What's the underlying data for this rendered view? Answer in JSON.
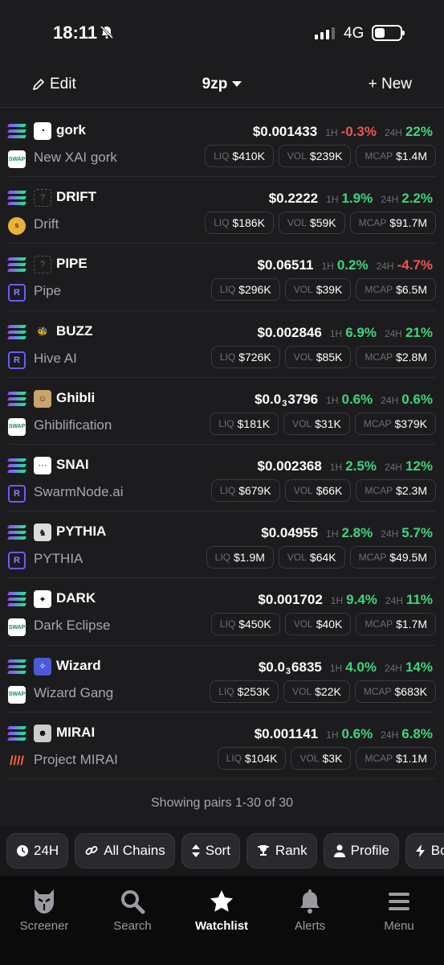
{
  "status_bar": {
    "time": "18:11",
    "network": "4G"
  },
  "nav": {
    "edit_label": "Edit",
    "title": "9zp",
    "new_label": "+ New"
  },
  "labels": {
    "h1": "1H",
    "h24": "24H",
    "liq": "LIQ",
    "vol": "VOL",
    "mcap": "MCAP"
  },
  "pairs": [
    {
      "symbol": "gork",
      "name": "New XAI gork",
      "dex": "swap",
      "price": "$0.001433",
      "price_zeros": "",
      "price_tail": "",
      "change_1h": "-0.3%",
      "change_24h": "22%",
      "liq": "$410K",
      "vol": "$239K",
      "mcap": "$1.4M"
    },
    {
      "symbol": "DRIFT",
      "name": "Drift",
      "dex": "drift",
      "price": "$0.2222",
      "price_zeros": "",
      "price_tail": "",
      "change_1h": "1.9%",
      "change_24h": "2.2%",
      "liq": "$186K",
      "vol": "$59K",
      "mcap": "$91.7M"
    },
    {
      "symbol": "PIPE",
      "name": "Pipe",
      "dex": "raydium",
      "price": "$0.06511",
      "price_zeros": "",
      "price_tail": "",
      "change_1h": "0.2%",
      "change_24h": "-4.7%",
      "liq": "$296K",
      "vol": "$39K",
      "mcap": "$6.5M"
    },
    {
      "symbol": "BUZZ",
      "name": "Hive AI",
      "dex": "raydium",
      "price": "$0.002846",
      "price_zeros": "",
      "price_tail": "",
      "change_1h": "6.9%",
      "change_24h": "21%",
      "liq": "$726K",
      "vol": "$85K",
      "mcap": "$2.8M"
    },
    {
      "symbol": "Ghibli",
      "name": "Ghiblification",
      "dex": "swap",
      "price": "$0.0",
      "price_zeros": "3",
      "price_tail": "3796",
      "change_1h": "0.6%",
      "change_24h": "0.6%",
      "liq": "$181K",
      "vol": "$31K",
      "mcap": "$379K"
    },
    {
      "symbol": "SNAI",
      "name": "SwarmNode.ai",
      "dex": "raydium",
      "price": "$0.002368",
      "price_zeros": "",
      "price_tail": "",
      "change_1h": "2.5%",
      "change_24h": "12%",
      "liq": "$679K",
      "vol": "$66K",
      "mcap": "$2.3M"
    },
    {
      "symbol": "PYTHIA",
      "name": "PYTHIA",
      "dex": "raydium",
      "price": "$0.04955",
      "price_zeros": "",
      "price_tail": "",
      "change_1h": "2.8%",
      "change_24h": "5.7%",
      "liq": "$1.9M",
      "vol": "$64K",
      "mcap": "$49.5M"
    },
    {
      "symbol": "DARK",
      "name": "Dark Eclipse",
      "dex": "swap",
      "price": "$0.001702",
      "price_zeros": "",
      "price_tail": "",
      "change_1h": "9.4%",
      "change_24h": "11%",
      "liq": "$450K",
      "vol": "$40K",
      "mcap": "$1.7M"
    },
    {
      "symbol": "Wizard",
      "name": "Wizard Gang",
      "dex": "swap",
      "price": "$0.0",
      "price_zeros": "3",
      "price_tail": "6835",
      "change_1h": "4.0%",
      "change_24h": "14%",
      "liq": "$253K",
      "vol": "$22K",
      "mcap": "$683K"
    },
    {
      "symbol": "MIRAI",
      "name": "Project MIRAI",
      "dex": "mirai",
      "price": "$0.001141",
      "price_zeros": "",
      "price_tail": "",
      "change_1h": "0.6%",
      "change_24h": "6.8%",
      "liq": "$104K",
      "vol": "$3K",
      "mcap": "$1.1M"
    }
  ],
  "showing_text": "Showing pairs 1-30 of 30",
  "filters": [
    {
      "label": "24H",
      "icon": "clock-icon"
    },
    {
      "label": "All Chains",
      "icon": "link-icon"
    },
    {
      "label": "Sort",
      "icon": "sort-icon"
    },
    {
      "label": "Rank",
      "icon": "trophy-icon"
    },
    {
      "label": "Profile",
      "icon": "profile-icon"
    },
    {
      "label": "Boos",
      "icon": "bolt-icon"
    }
  ],
  "tabs": [
    {
      "label": "Screener",
      "icon": "owl-icon",
      "active": false
    },
    {
      "label": "Search",
      "icon": "search-icon",
      "active": false
    },
    {
      "label": "Watchlist",
      "icon": "star-icon",
      "active": true
    },
    {
      "label": "Alerts",
      "icon": "bell-icon",
      "active": false
    },
    {
      "label": "Menu",
      "icon": "menu-icon",
      "active": false
    }
  ],
  "colors": {
    "background": "#1c1c1e",
    "positive": "#3ed67a",
    "negative": "#f0544f",
    "muted": "#a6a6ad"
  }
}
